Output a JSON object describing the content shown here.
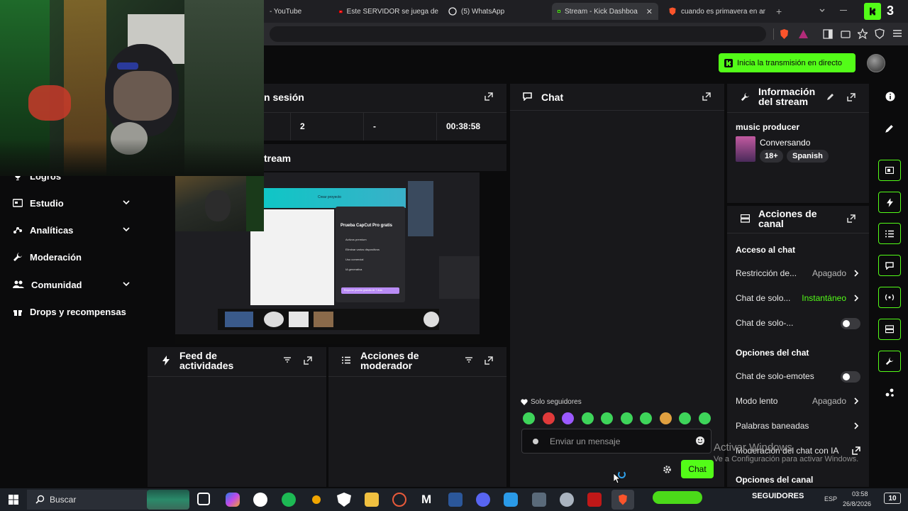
{
  "browser": {
    "tabs": [
      {
        "title": "- YouTube",
        "icon": "youtube-icon"
      },
      {
        "title": "Este SERVIDOR se juega de",
        "icon": "youtube-icon"
      },
      {
        "title": "(5) WhatsApp",
        "icon": "whatsapp-icon"
      },
      {
        "title": "Stream - Kick Dashboa",
        "icon": "kick-icon",
        "active": true
      },
      {
        "title": "cuando es primavera en ar",
        "icon": "brave-icon"
      }
    ],
    "new_tab": "+",
    "kick_badge": "3"
  },
  "header": {
    "go_live_label": "Inicia la transmisión en directo"
  },
  "nav": {
    "items": [
      {
        "label": "Logros",
        "icon": "trophy-icon",
        "has_chevron": false
      },
      {
        "label": "Estudio",
        "icon": "studio-icon",
        "has_chevron": true
      },
      {
        "label": "Analíticas",
        "icon": "analytics-icon",
        "has_chevron": true
      },
      {
        "label": "Moderación",
        "icon": "wrench-icon",
        "has_chevron": false
      },
      {
        "label": "Comunidad",
        "icon": "community-icon",
        "has_chevron": true
      },
      {
        "label": "Drops y recompensas",
        "icon": "gift-icon",
        "has_chevron": false
      }
    ]
  },
  "session": {
    "title_fragment": "n sesión",
    "stats": [
      "2",
      "-",
      "00:38:58"
    ]
  },
  "stream_panel": {
    "title_fragment": "tream"
  },
  "preview": {
    "capcut_title": "Prueba CapCut Pro gratis",
    "capcut_items": [
      "Activos premium",
      "Eliminar varios dispositivos",
      "Uso comercial",
      "IA generativa"
    ],
    "capcut_button": "Empezar prueba gratuita de 7 días",
    "create_project": "Crear proyecto"
  },
  "activity_feed": {
    "title": "Feed de actividades"
  },
  "mod_actions": {
    "title": "Acciones de moderador"
  },
  "chat": {
    "title": "Chat",
    "followers_only": "Solo seguidores",
    "placeholder": "Enviar un mensaje",
    "send_label": "Chat",
    "emote_colors": [
      "#3ed45a",
      "#e03a3a",
      "#9b59ff",
      "#3ed45a",
      "#3ed45a",
      "#3ed45a",
      "#3ed45a",
      "#e0a040",
      "#3ed45a",
      "#3ed45a"
    ]
  },
  "stream_info": {
    "title": "Información del stream",
    "stream_title": "music producer",
    "category": "Conversando",
    "tags": [
      "18+",
      "Spanish"
    ]
  },
  "channel_actions": {
    "title": "Acciones de canal",
    "chat_access_heading": "Acceso al chat",
    "rows": [
      {
        "label": "Restricción de...",
        "value": "Apagado",
        "kind": "arrow"
      },
      {
        "label": "Chat de solo...",
        "value": "Instantáneo",
        "kind": "arrow",
        "green": true
      },
      {
        "label": "Chat de solo-...",
        "value": "",
        "kind": "toggle"
      }
    ],
    "chat_options_heading": "Opciones del chat",
    "rows2": [
      {
        "label": "Chat de solo-emotes",
        "value": "",
        "kind": "toggle"
      },
      {
        "label": "Modo lento",
        "value": "Apagado",
        "kind": "arrow"
      },
      {
        "label": "Palabras baneadas",
        "value": "",
        "kind": "arrow"
      },
      {
        "label": "Moderación del chat con IA",
        "value": "",
        "kind": "external"
      }
    ],
    "channel_options_heading": "Opciones del canal"
  },
  "watermark": {
    "line1": "Activar Windows",
    "line2": "Ve a Configuración para activar Windows."
  },
  "taskbar": {
    "search_label": "Buscar",
    "followers_label": "SEGUIDORES",
    "lang": "ESP",
    "time": "03:58",
    "date": "26/8/2026",
    "notif_count": "10"
  },
  "colors": {
    "accent": "#53fc18",
    "panel": "#18181b",
    "bg": "#0b0b0c"
  }
}
